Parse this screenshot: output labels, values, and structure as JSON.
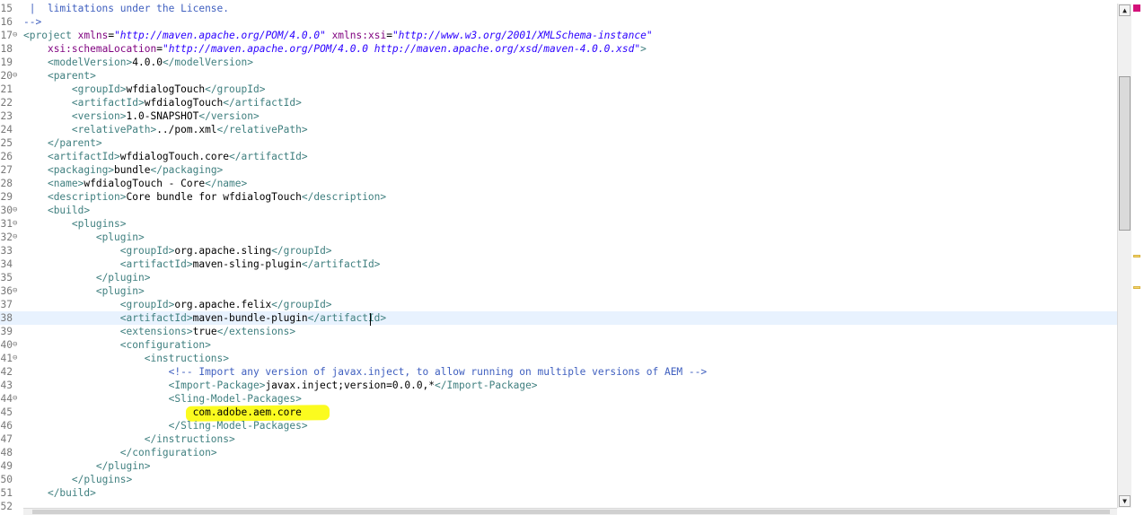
{
  "editor": {
    "current_line": "38",
    "lines": [
      {
        "num": "15",
        "fold": "",
        "segs": [
          {
            "c": "t-com",
            "t": " |  limitations under the License."
          }
        ]
      },
      {
        "num": "16",
        "fold": "",
        "segs": [
          {
            "c": "t-com",
            "t": "-->"
          }
        ]
      },
      {
        "num": "17",
        "fold": "⊖",
        "segs": [
          {
            "c": "t-tag",
            "t": "<project "
          },
          {
            "c": "t-attr",
            "t": "xmlns"
          },
          {
            "c": "t-pun",
            "t": "="
          },
          {
            "c": "t-val",
            "t": "\"http://maven.apache.org/POM/4.0.0\""
          },
          {
            "c": "t-pun",
            "t": " "
          },
          {
            "c": "t-attr",
            "t": "xmlns:xsi"
          },
          {
            "c": "t-pun",
            "t": "="
          },
          {
            "c": "t-val",
            "t": "\"http://www.w3.org/2001/XMLSchema-instance\""
          }
        ]
      },
      {
        "num": "18",
        "fold": "",
        "segs": [
          {
            "c": "t-pun",
            "t": "    "
          },
          {
            "c": "t-attr",
            "t": "xsi:schemaLocation"
          },
          {
            "c": "t-pun",
            "t": "="
          },
          {
            "c": "t-val",
            "t": "\"http://maven.apache.org/POM/4.0.0 http://maven.apache.org/xsd/maven-4.0.0.xsd\""
          },
          {
            "c": "t-tag",
            "t": ">"
          }
        ]
      },
      {
        "num": "19",
        "fold": "",
        "segs": [
          {
            "c": "t-pun",
            "t": "    "
          },
          {
            "c": "t-tag",
            "t": "<modelVersion>"
          },
          {
            "c": "t-text",
            "t": "4.0.0"
          },
          {
            "c": "t-tag",
            "t": "</modelVersion>"
          }
        ]
      },
      {
        "num": "20",
        "fold": "⊖",
        "segs": [
          {
            "c": "t-pun",
            "t": "    "
          },
          {
            "c": "t-tag",
            "t": "<parent>"
          }
        ]
      },
      {
        "num": "21",
        "fold": "",
        "segs": [
          {
            "c": "t-pun",
            "t": "        "
          },
          {
            "c": "t-tag",
            "t": "<groupId>"
          },
          {
            "c": "t-text",
            "t": "wfdialogTouch"
          },
          {
            "c": "t-tag",
            "t": "</groupId>"
          }
        ]
      },
      {
        "num": "22",
        "fold": "",
        "segs": [
          {
            "c": "t-pun",
            "t": "        "
          },
          {
            "c": "t-tag",
            "t": "<artifactId>"
          },
          {
            "c": "t-text",
            "t": "wfdialogTouch"
          },
          {
            "c": "t-tag",
            "t": "</artifactId>"
          }
        ]
      },
      {
        "num": "23",
        "fold": "",
        "segs": [
          {
            "c": "t-pun",
            "t": "        "
          },
          {
            "c": "t-tag",
            "t": "<version>"
          },
          {
            "c": "t-text",
            "t": "1.0-SNAPSHOT"
          },
          {
            "c": "t-tag",
            "t": "</version>"
          }
        ]
      },
      {
        "num": "24",
        "fold": "",
        "segs": [
          {
            "c": "t-pun",
            "t": "        "
          },
          {
            "c": "t-tag",
            "t": "<relativePath>"
          },
          {
            "c": "t-text",
            "t": "../pom.xml"
          },
          {
            "c": "t-tag",
            "t": "</relativePath>"
          }
        ]
      },
      {
        "num": "25",
        "fold": "",
        "segs": [
          {
            "c": "t-pun",
            "t": "    "
          },
          {
            "c": "t-tag",
            "t": "</parent>"
          }
        ]
      },
      {
        "num": "26",
        "fold": "",
        "segs": [
          {
            "c": "t-pun",
            "t": "    "
          },
          {
            "c": "t-tag",
            "t": "<artifactId>"
          },
          {
            "c": "t-text",
            "t": "wfdialogTouch.core"
          },
          {
            "c": "t-tag",
            "t": "</artifactId>"
          }
        ]
      },
      {
        "num": "27",
        "fold": "",
        "segs": [
          {
            "c": "t-pun",
            "t": "    "
          },
          {
            "c": "t-tag",
            "t": "<packaging>"
          },
          {
            "c": "t-text",
            "t": "bundle"
          },
          {
            "c": "t-tag",
            "t": "</packaging>"
          }
        ]
      },
      {
        "num": "28",
        "fold": "",
        "segs": [
          {
            "c": "t-pun",
            "t": "    "
          },
          {
            "c": "t-tag",
            "t": "<name>"
          },
          {
            "c": "t-text",
            "t": "wfdialogTouch - Core"
          },
          {
            "c": "t-tag",
            "t": "</name>"
          }
        ]
      },
      {
        "num": "29",
        "fold": "",
        "segs": [
          {
            "c": "t-pun",
            "t": "    "
          },
          {
            "c": "t-tag",
            "t": "<description>"
          },
          {
            "c": "t-text",
            "t": "Core bundle for wfdialogTouch"
          },
          {
            "c": "t-tag",
            "t": "</description>"
          }
        ]
      },
      {
        "num": "30",
        "fold": "⊖",
        "segs": [
          {
            "c": "t-pun",
            "t": "    "
          },
          {
            "c": "t-tag",
            "t": "<build>"
          }
        ]
      },
      {
        "num": "31",
        "fold": "⊖",
        "segs": [
          {
            "c": "t-pun",
            "t": "        "
          },
          {
            "c": "t-tag",
            "t": "<plugins>"
          }
        ]
      },
      {
        "num": "32",
        "fold": "⊖",
        "segs": [
          {
            "c": "t-pun",
            "t": "            "
          },
          {
            "c": "t-tag",
            "t": "<plugin>"
          }
        ]
      },
      {
        "num": "33",
        "fold": "",
        "segs": [
          {
            "c": "t-pun",
            "t": "                "
          },
          {
            "c": "t-tag",
            "t": "<groupId>"
          },
          {
            "c": "t-text",
            "t": "org.apache.sling"
          },
          {
            "c": "t-tag",
            "t": "</groupId>"
          }
        ]
      },
      {
        "num": "34",
        "fold": "",
        "segs": [
          {
            "c": "t-pun",
            "t": "                "
          },
          {
            "c": "t-tag",
            "t": "<artifactId>"
          },
          {
            "c": "t-text",
            "t": "maven-sling-plugin"
          },
          {
            "c": "t-tag",
            "t": "</artifactId>"
          }
        ]
      },
      {
        "num": "35",
        "fold": "",
        "segs": [
          {
            "c": "t-pun",
            "t": "            "
          },
          {
            "c": "t-tag",
            "t": "</plugin>"
          }
        ]
      },
      {
        "num": "36",
        "fold": "⊖",
        "segs": [
          {
            "c": "t-pun",
            "t": "            "
          },
          {
            "c": "t-tag",
            "t": "<plugin>"
          }
        ]
      },
      {
        "num": "37",
        "fold": "",
        "segs": [
          {
            "c": "t-pun",
            "t": "                "
          },
          {
            "c": "t-tag",
            "t": "<groupId>"
          },
          {
            "c": "t-text",
            "t": "org.apache.felix"
          },
          {
            "c": "t-tag",
            "t": "</groupId>"
          }
        ]
      },
      {
        "num": "38",
        "fold": "",
        "segs": [
          {
            "c": "t-pun",
            "t": "                "
          },
          {
            "c": "t-tag",
            "t": "<artifactId>"
          },
          {
            "c": "t-text",
            "t": "maven-bundle-plugin"
          },
          {
            "c": "t-tag",
            "t": "</artifactId>"
          }
        ]
      },
      {
        "num": "39",
        "fold": "",
        "segs": [
          {
            "c": "t-pun",
            "t": "                "
          },
          {
            "c": "t-tag",
            "t": "<extensions>"
          },
          {
            "c": "t-text",
            "t": "true"
          },
          {
            "c": "t-tag",
            "t": "</extensions>"
          }
        ]
      },
      {
        "num": "40",
        "fold": "⊖",
        "segs": [
          {
            "c": "t-pun",
            "t": "                "
          },
          {
            "c": "t-tag",
            "t": "<configuration>"
          }
        ]
      },
      {
        "num": "41",
        "fold": "⊖",
        "segs": [
          {
            "c": "t-pun",
            "t": "                    "
          },
          {
            "c": "t-tag",
            "t": "<instructions>"
          }
        ]
      },
      {
        "num": "42",
        "fold": "",
        "segs": [
          {
            "c": "t-pun",
            "t": "                        "
          },
          {
            "c": "t-com",
            "t": "<!-- Import any version of javax.inject, to allow running on multiple versions of AEM -->"
          }
        ]
      },
      {
        "num": "43",
        "fold": "",
        "segs": [
          {
            "c": "t-pun",
            "t": "                        "
          },
          {
            "c": "t-tag",
            "t": "<Import-Package>"
          },
          {
            "c": "t-text",
            "t": "javax.inject;version=0.0.0,*"
          },
          {
            "c": "t-tag",
            "t": "</Import-Package>"
          }
        ]
      },
      {
        "num": "44",
        "fold": "⊖",
        "segs": [
          {
            "c": "t-pun",
            "t": "                        "
          },
          {
            "c": "t-tag",
            "t": "<Sling-Model-Packages>"
          }
        ]
      },
      {
        "num": "45",
        "fold": "",
        "segs": [
          {
            "c": "t-pun",
            "t": "                            "
          },
          {
            "c": "t-text",
            "t": "com.adobe.aem.core"
          }
        ]
      },
      {
        "num": "46",
        "fold": "",
        "segs": [
          {
            "c": "t-pun",
            "t": "                        "
          },
          {
            "c": "t-tag",
            "t": "</Sling-Model-Packages>"
          }
        ]
      },
      {
        "num": "47",
        "fold": "",
        "segs": [
          {
            "c": "t-pun",
            "t": "                    "
          },
          {
            "c": "t-tag",
            "t": "</instructions>"
          }
        ]
      },
      {
        "num": "48",
        "fold": "",
        "segs": [
          {
            "c": "t-pun",
            "t": "                "
          },
          {
            "c": "t-tag",
            "t": "</configuration>"
          }
        ]
      },
      {
        "num": "49",
        "fold": "",
        "segs": [
          {
            "c": "t-pun",
            "t": "            "
          },
          {
            "c": "t-tag",
            "t": "</plugin>"
          }
        ]
      },
      {
        "num": "50",
        "fold": "",
        "segs": [
          {
            "c": "t-pun",
            "t": "        "
          },
          {
            "c": "t-tag",
            "t": "</plugins>"
          }
        ]
      },
      {
        "num": "51",
        "fold": "",
        "segs": [
          {
            "c": "t-pun",
            "t": "    "
          },
          {
            "c": "t-tag",
            "t": "</build>"
          }
        ]
      },
      {
        "num": "52",
        "fold": "",
        "segs": []
      }
    ]
  },
  "scrollbar": {
    "up_icon": "▲",
    "down_icon": "▼"
  },
  "colors": {
    "highlight": "#fbfb1f",
    "tag": "#3f7f7f",
    "attr": "#7f007f",
    "value": "#2a00ff",
    "comment": "#3f5fbf",
    "error_marker": "#d4117a",
    "warning_marker": "#f5d76e"
  }
}
